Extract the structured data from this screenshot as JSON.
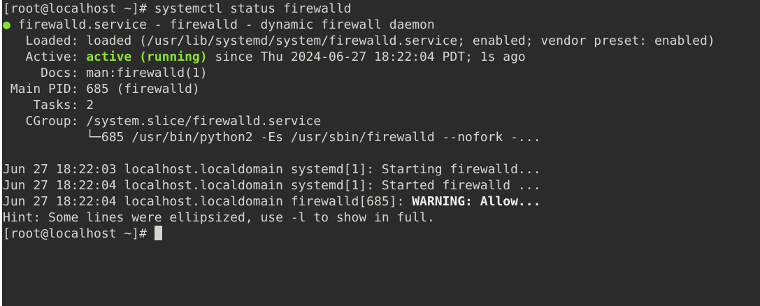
{
  "terminal": {
    "prompt": "[root@localhost ~]# ",
    "command": "systemctl status firewalld",
    "status_dot": "●",
    "unit_header": " firewalld.service - firewalld - dynamic firewall daemon",
    "loaded": "   Loaded: loaded (/usr/lib/systemd/system/firewalld.service; enabled; vendor preset: enabled)",
    "active_label": "   Active: ",
    "active_state": "active (running)",
    "active_since": " since Thu 2024-06-27 18:22:04 PDT; 1s ago",
    "docs": "     Docs: man:firewalld(1)",
    "main_pid": " Main PID: 685 (firewalld)",
    "tasks": "    Tasks: 2",
    "cgroup": "   CGroup: /system.slice/firewalld.service",
    "cgroup_child": "           └─685 /usr/bin/python2 -Es /usr/sbin/firewalld --nofork -...",
    "log1": "Jun 27 18:22:03 localhost.localdomain systemd[1]: Starting firewalld...",
    "log2": "Jun 27 18:22:04 localhost.localdomain systemd[1]: Started firewalld ...",
    "log3_prefix": "Jun 27 18:22:04 localhost.localdomain firewalld[685]: ",
    "log3_warning": "WARNING: Allow...",
    "hint": "Hint: Some lines were ellipsized, use -l to show in full.",
    "final_prompt": "[root@localhost ~]# "
  },
  "colors": {
    "background": "#2b2b2b",
    "foreground": "#d3d7cf",
    "active_green": "#8ae234"
  }
}
